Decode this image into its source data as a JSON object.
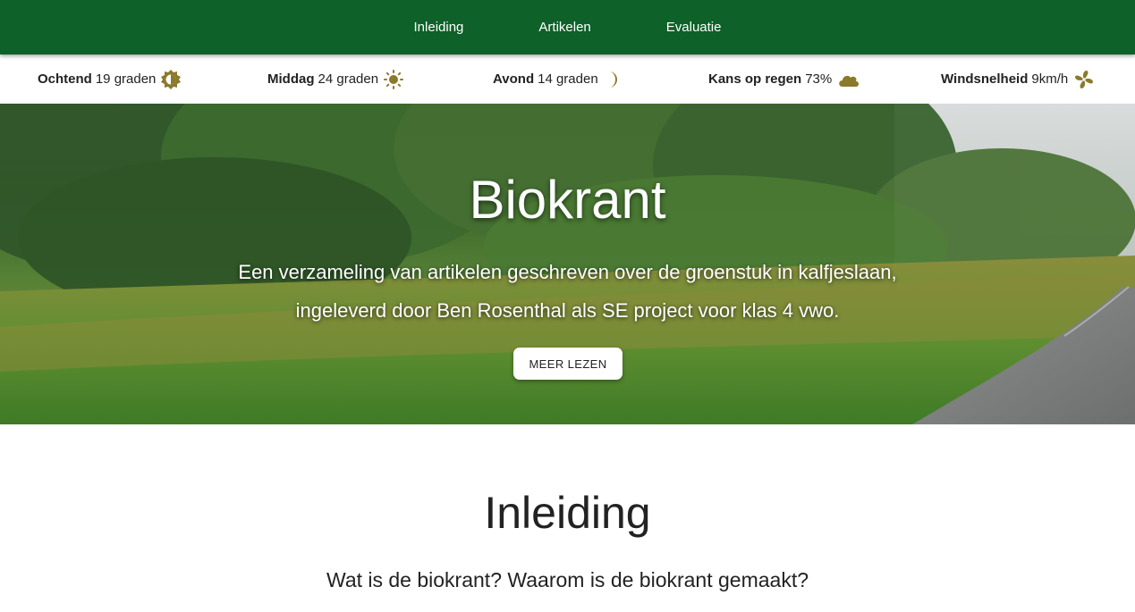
{
  "nav": {
    "items": [
      {
        "label": "Inleiding"
      },
      {
        "label": "Artikelen"
      },
      {
        "label": "Evaluatie"
      }
    ]
  },
  "weather": {
    "morning": {
      "label": "Ochtend",
      "value": "19 graden",
      "icon": "sun-half-icon"
    },
    "noon": {
      "label": "Middag",
      "value": "24 graden",
      "icon": "sun-icon"
    },
    "evening": {
      "label": "Avond",
      "value": "14 graden",
      "icon": "moon-icon"
    },
    "rain": {
      "label": "Kans op regen",
      "value": "73%",
      "icon": "cloud-icon"
    },
    "wind": {
      "label": "Windsnelheid",
      "value": "9km/h",
      "icon": "fan-icon"
    },
    "icon_color": "#8a7a2a"
  },
  "hero": {
    "title": "Biokrant",
    "subtitle_line1": "Een verzameling van artikelen geschreven over de groenstuk in kalfjeslaan,",
    "subtitle_line2": "ingeleverd door Ben Rosenthal als SE project voor klas 4 vwo.",
    "button_label": "MEER LEZEN"
  },
  "intro": {
    "title": "Inleiding",
    "subtitle": "Wat is de biokrant? Waarom is de biokrant gemaakt?"
  },
  "colors": {
    "nav_bg": "#0e6128",
    "text": "#222222"
  }
}
